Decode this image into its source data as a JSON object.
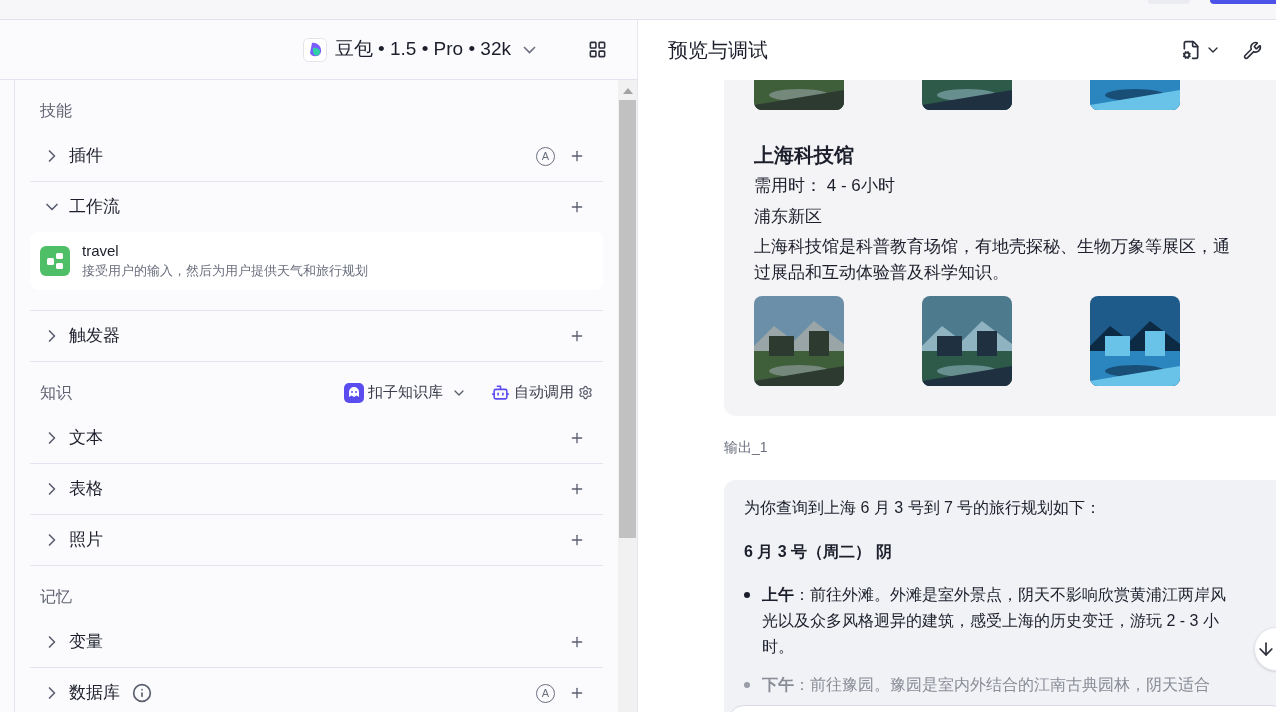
{
  "model_selector": {
    "label": "豆包 • 1.5 • Pro • 32k"
  },
  "sections": [
    {
      "title": "技能",
      "groups": [
        {
          "label": "插件",
          "expanded": false,
          "badge": "A"
        },
        {
          "label": "工作流",
          "expanded": true,
          "items": [
            {
              "name": "travel",
              "description": "接受用户的输入，然后为用户提供天气和旅行规划"
            }
          ]
        },
        {
          "label": "触发器",
          "expanded": false
        }
      ]
    },
    {
      "title": "知识",
      "source": "扣子知识库",
      "mode": "自动调用",
      "groups": [
        {
          "label": "文本",
          "expanded": false
        },
        {
          "label": "表格",
          "expanded": false
        },
        {
          "label": "照片",
          "expanded": false
        }
      ]
    },
    {
      "title": "记忆",
      "groups": [
        {
          "label": "变量",
          "expanded": false
        },
        {
          "label": "数据库",
          "expanded": false,
          "info": true,
          "badge": "A"
        }
      ]
    }
  ],
  "preview": {
    "title": "预览与调试",
    "attraction": {
      "name": "上海科技馆",
      "duration": "需用时： 4 - 6小时",
      "district": "浦东新区",
      "description": "上海科技馆是科普教育场馆，有地壳探秘、生物万象等展区，通过展品和互动体验普及科学知识。"
    },
    "output_label": "输出_1",
    "message": {
      "intro": "为你查询到上海 6 月 3 号到 7 号的旅行规划如下：",
      "day": "6 月 3 号（周二） 阴",
      "items": [
        {
          "text": "**上午**：前往外滩。外滩是室外景点，阴天不影响欣赏黄浦江两岸风光以及众多风格迥异的建筑，感受上海的历史变迁，游玩 2 - 3 小时。",
          "faded": false
        },
        {
          "text": "**下午**：前往豫园。豫园是室内外结合的江南古典园林，阴天适合",
          "faded": true
        }
      ]
    }
  }
}
